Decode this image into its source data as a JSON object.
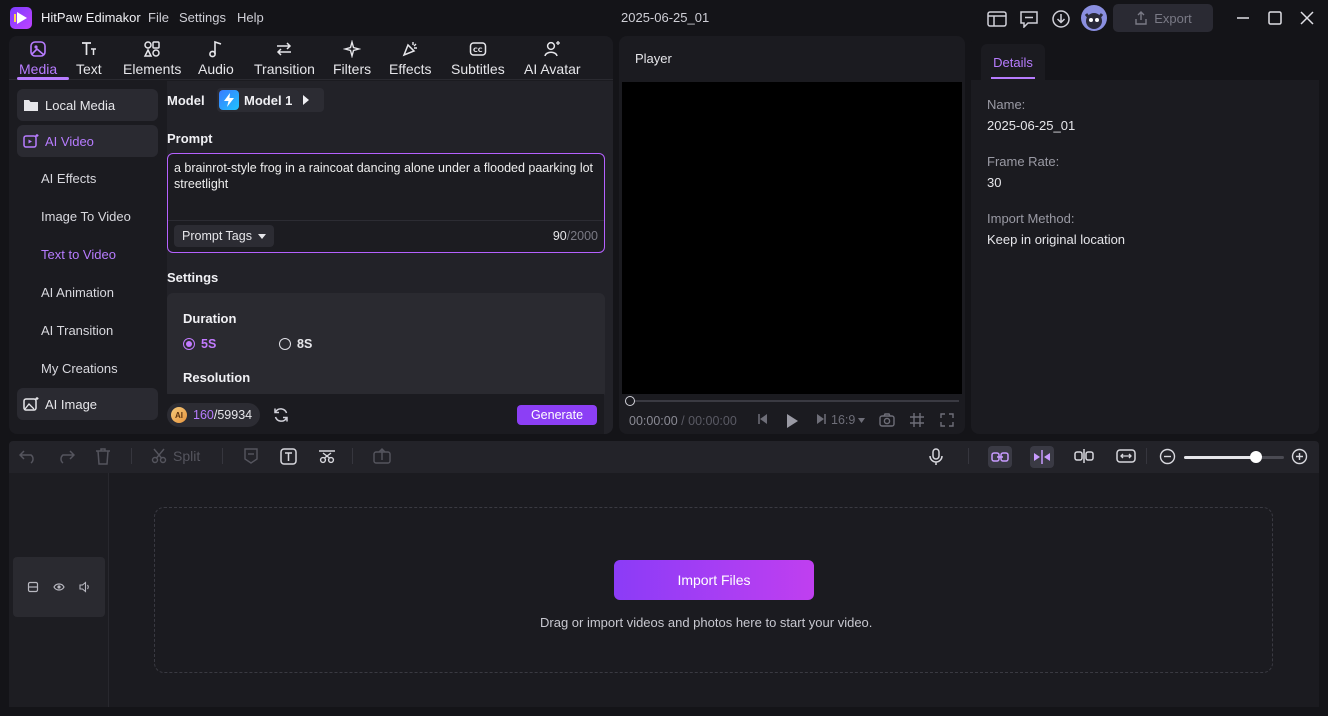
{
  "titlebar": {
    "app_name": "HitPaw Edimakor",
    "menu": [
      "File",
      "Settings",
      "Help"
    ],
    "document_title": "2025-06-25_01",
    "export_label": "Export"
  },
  "tabs": [
    {
      "label": "Media",
      "icon": "media-icon",
      "active": true
    },
    {
      "label": "Text",
      "icon": "text-icon"
    },
    {
      "label": "Elements",
      "icon": "elements-icon"
    },
    {
      "label": "Audio",
      "icon": "audio-icon"
    },
    {
      "label": "Transition",
      "icon": "transition-icon"
    },
    {
      "label": "Filters",
      "icon": "filters-icon"
    },
    {
      "label": "Effects",
      "icon": "effects-icon"
    },
    {
      "label": "Subtitles",
      "icon": "subtitles-icon"
    },
    {
      "label": "AI Avatar",
      "icon": "ai-avatar-icon"
    }
  ],
  "nav": {
    "local_media": "Local Media",
    "ai_video": "AI Video",
    "sub_items": [
      "AI Effects",
      "Image To Video",
      "Text to Video",
      "AI Animation",
      "AI Transition",
      "My Creations"
    ],
    "active_sub": "Text to Video",
    "ai_image": "AI Image"
  },
  "form": {
    "model_label": "Model",
    "model_value": "Model 1",
    "prompt_label": "Prompt",
    "prompt_text": "a brainrot-style frog in a raincoat dancing alone under a flooded paarking lot streetlight",
    "prompt_tags_label": "Prompt Tags",
    "char_count": "90",
    "char_max": "/2000",
    "settings_label": "Settings",
    "duration_label": "Duration",
    "duration_options": [
      "5S",
      "8S"
    ],
    "duration_selected": "5S",
    "resolution_label": "Resolution"
  },
  "credits": {
    "coin_label": "AI",
    "used": "160",
    "total": "/59934"
  },
  "generate_label": "Generate",
  "player": {
    "title": "Player",
    "current_time": "00:00:00",
    "separator": "/",
    "total_time": "00:00:00",
    "aspect_ratio": "16:9"
  },
  "details": {
    "tab_label": "Details",
    "fields": [
      {
        "label": "Name:",
        "value": "2025-06-25_01"
      },
      {
        "label": "Frame Rate:",
        "value": "30"
      },
      {
        "label": "Import Method:",
        "value": "Keep in original location"
      }
    ]
  },
  "timeline": {
    "split_label": "Split",
    "zoom_level": 0.72,
    "import_label": "Import Files",
    "drop_hint": "Drag or import videos and photos here to start your video."
  },
  "colors": {
    "accent": "#b77cff",
    "accent_button": "#8c3ff5",
    "background": "#141418",
    "panel": "#1b1b20"
  }
}
